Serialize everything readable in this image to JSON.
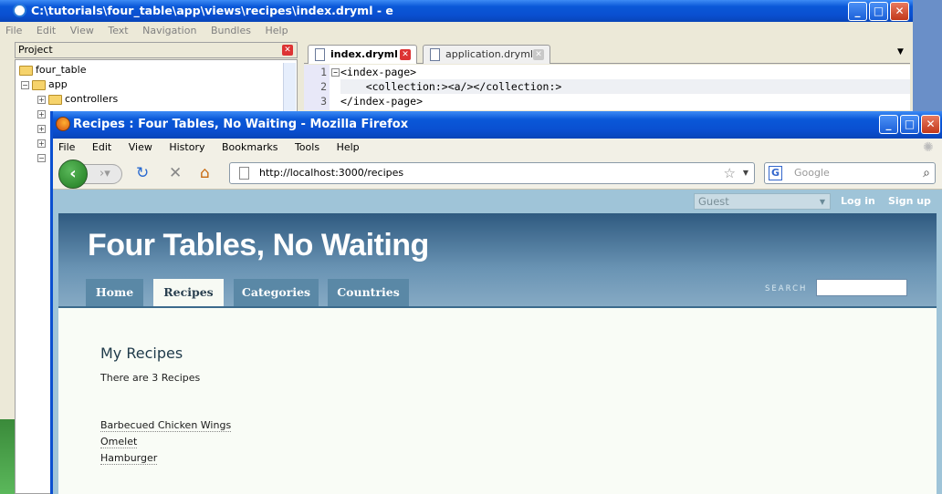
{
  "editor": {
    "title": "C:\\tutorials\\four_table\\app\\views\\recipes\\index.dryml - e",
    "menu": [
      "File",
      "Edit",
      "View",
      "Text",
      "Navigation",
      "Bundles",
      "Help"
    ],
    "project_label": "Project",
    "tree": [
      "four_table",
      "app",
      "controllers"
    ],
    "tabs": [
      "index.dryml",
      "application.dryml"
    ],
    "line_numbers": [
      "1",
      "2",
      "3"
    ],
    "code_lines": [
      "<index-page>",
      "    <collection:><a/></collection:>",
      "</index-page>"
    ]
  },
  "firefox": {
    "title": "Recipes : Four Tables, No Waiting - Mozilla Firefox",
    "menu": [
      "File",
      "Edit",
      "View",
      "History",
      "Bookmarks",
      "Tools",
      "Help"
    ],
    "url": "http://localhost:3000/recipes",
    "search_placeholder": "Google",
    "search_engine_icon": "G"
  },
  "page": {
    "user_select": "Guest",
    "login": "Log in",
    "signup": "Sign up",
    "site_title": "Four Tables, No Waiting",
    "nav": [
      "Home",
      "Recipes",
      "Categories",
      "Countries"
    ],
    "active_nav": "Recipes",
    "search_label": "SEARCH",
    "heading": "My Recipes",
    "count_text": "There are 3 Recipes",
    "recipes": [
      "Barbecued Chicken Wings",
      "Omelet",
      "Hamburger"
    ]
  },
  "colors": {
    "xp_blue": "#0a4fd0",
    "banner": "#4a7698",
    "nav_tab": "#5a88a6",
    "content_bg": "#f9fcf6"
  }
}
